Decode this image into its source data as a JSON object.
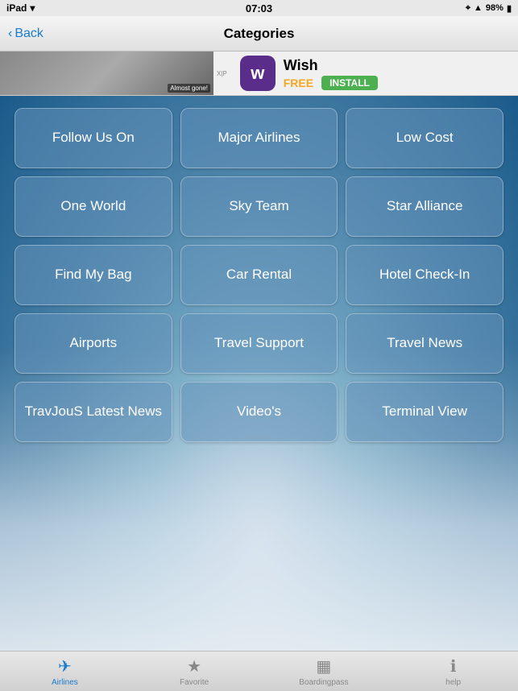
{
  "statusBar": {
    "device": "iPad",
    "time": "07:03",
    "signal": "●",
    "wifi": "wifi",
    "bluetooth": "BT",
    "battery": "98%"
  },
  "navBar": {
    "backLabel": "Back",
    "title": "Categories"
  },
  "ad": {
    "almostGone": "Almost gone!",
    "wishName": "Wish",
    "wishIcon": "w",
    "freeLabel": "FREE",
    "installLabel": "INSTALL"
  },
  "grid": {
    "buttons": [
      {
        "id": "follow-us-on",
        "label": "Follow Us On"
      },
      {
        "id": "major-airlines",
        "label": "Major Airlines"
      },
      {
        "id": "low-cost",
        "label": "Low Cost"
      },
      {
        "id": "one-world",
        "label": "One World"
      },
      {
        "id": "sky-team",
        "label": "Sky Team"
      },
      {
        "id": "star-alliance",
        "label": "Star Alliance"
      },
      {
        "id": "find-my-bag",
        "label": "Find My Bag"
      },
      {
        "id": "car-rental",
        "label": "Car Rental"
      },
      {
        "id": "hotel-check-in",
        "label": "Hotel Check-In"
      },
      {
        "id": "airports",
        "label": "Airports"
      },
      {
        "id": "travel-support",
        "label": "Travel Support"
      },
      {
        "id": "travel-news",
        "label": "Travel News"
      },
      {
        "id": "travjous-latest-news",
        "label": "TravJouS Latest News"
      },
      {
        "id": "videos",
        "label": "Video's"
      },
      {
        "id": "terminal-view",
        "label": "Terminal View"
      }
    ]
  },
  "tabBar": {
    "tabs": [
      {
        "id": "airlines",
        "icon": "✈",
        "label": "Airlines",
        "active": true
      },
      {
        "id": "favorite",
        "icon": "★",
        "label": "Favorite",
        "active": false
      },
      {
        "id": "boardingpass",
        "icon": "▦",
        "label": "Boardingpass",
        "active": false
      },
      {
        "id": "help",
        "icon": "ℹ",
        "label": "help",
        "active": false
      }
    ]
  }
}
